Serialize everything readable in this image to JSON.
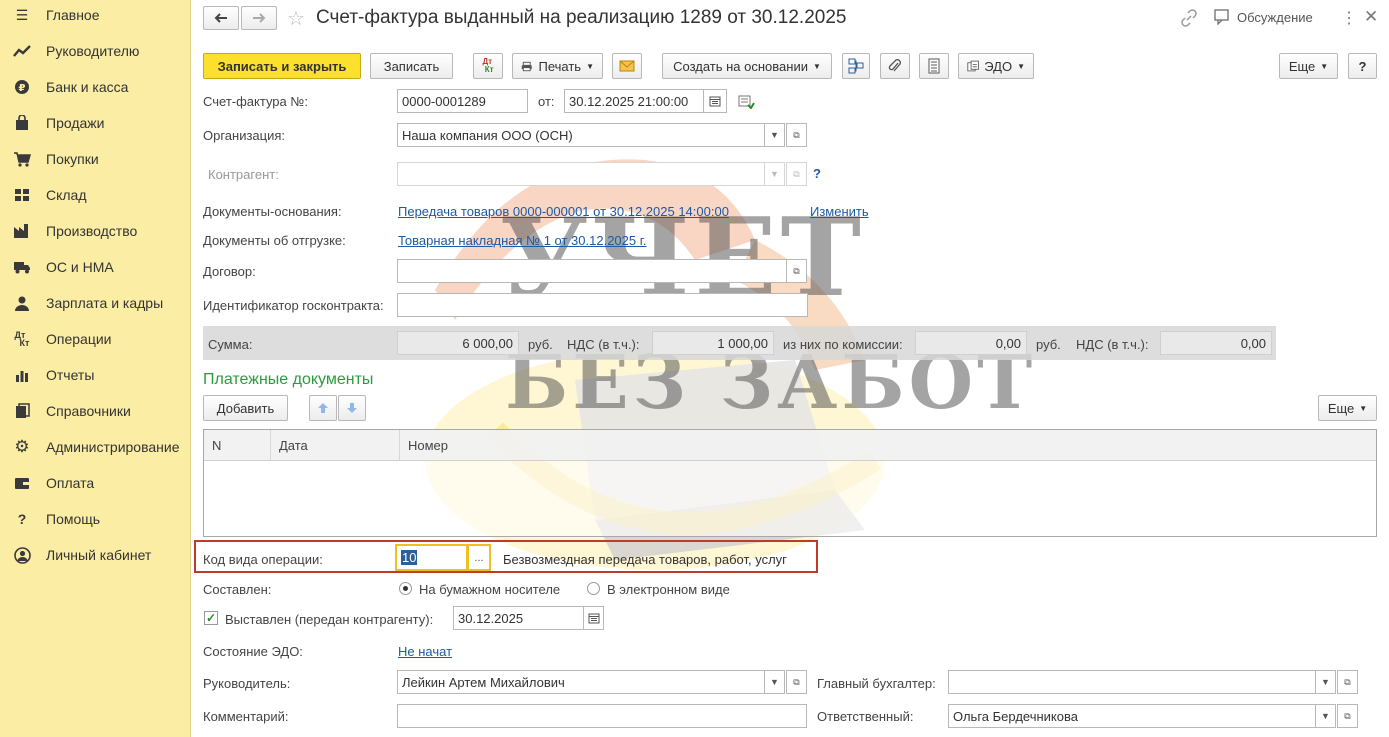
{
  "sidebar": {
    "menu_icon": "hamburger-icon",
    "items": [
      {
        "label": "Главное",
        "icon": "menu-icon"
      },
      {
        "label": "Руководителю",
        "icon": "trend-icon"
      },
      {
        "label": "Банк и касса",
        "icon": "coin-icon"
      },
      {
        "label": "Продажи",
        "icon": "bag-icon"
      },
      {
        "label": "Покупки",
        "icon": "cart-icon"
      },
      {
        "label": "Склад",
        "icon": "warehouse-icon"
      },
      {
        "label": "Производство",
        "icon": "factory-icon"
      },
      {
        "label": "ОС и НМА",
        "icon": "truck-icon"
      },
      {
        "label": "Зарплата и кадры",
        "icon": "person-icon"
      },
      {
        "label": "Операции",
        "icon": "dt-kt-icon"
      },
      {
        "label": "Отчеты",
        "icon": "bar-chart-icon"
      },
      {
        "label": "Справочники",
        "icon": "books-icon"
      },
      {
        "label": "Администрирование",
        "icon": "gear-icon"
      },
      {
        "label": "Оплата",
        "icon": "wallet-icon"
      },
      {
        "label": "Помощь",
        "icon": "question-icon"
      },
      {
        "label": "Личный кабинет",
        "icon": "user-circle-icon"
      }
    ]
  },
  "header": {
    "title": "Счет-фактура выданный на реализацию 1289 от 30.12.2025",
    "discussion": "Обсуждение"
  },
  "toolbar": {
    "save_close": "Записать и закрыть",
    "save": "Записать",
    "dtkt": "Дт\nКт",
    "print": "Печать",
    "create_based": "Создать на основании",
    "edo": "ЭДО",
    "more": "Еще",
    "help": "?"
  },
  "form": {
    "invoice_no_label": "Счет-фактура №:",
    "invoice_no": "0000-0001289",
    "from_label": "от:",
    "date": "30.12.2025 21:00:00",
    "org_label": "Организация:",
    "org": "Наша компания ООО (ОСН)",
    "counterparty_label": "Контрагент:",
    "counterparty": "",
    "counterparty_help": "?",
    "base_docs_label": "Документы-основания:",
    "base_docs_link": "Передача товаров 0000-000001 от 30.12.2025 14:00:00",
    "change_link": "Изменить",
    "shipment_docs_label": "Документы об отгрузке:",
    "shipment_docs_link": "Товарная накладная № 1 от 30.12.2025 г.",
    "contract_label": "Договор:",
    "contract": "",
    "gov_contract_label": "Идентификатор госконтракта:",
    "gov_contract": ""
  },
  "sums": {
    "sum_label": "Сумма:",
    "sum": "6 000,00",
    "currency1": "руб.",
    "vat_label": "НДС (в т.ч.):",
    "vat": "1 000,00",
    "commission_label": "из них по комиссии:",
    "commission": "0,00",
    "currency2": "руб.",
    "vat2_label": "НДС (в т.ч.):",
    "vat2": "0,00"
  },
  "payments": {
    "title": "Платежные документы",
    "add": "Добавить",
    "more": "Еще",
    "columns": [
      "N",
      "Дата",
      "Номер"
    ]
  },
  "operation": {
    "label": "Код вида операции:",
    "code": "10",
    "dots": "...",
    "description": "Безвозмездная передача товаров, работ, услуг"
  },
  "composed": {
    "label": "Составлен:",
    "paper": "На бумажном носителе",
    "electronic": "В электронном виде"
  },
  "issued": {
    "label": "Выставлен (передан контрагенту):",
    "date": "30.12.2025"
  },
  "edo_state": {
    "label": "Состояние ЭДО:",
    "value": "Не начат"
  },
  "signers": {
    "head_label": "Руководитель:",
    "head": "Лейкин Артем Михайлович",
    "chief_acc_label": "Главный бухгалтер:",
    "chief_acc": "",
    "comment_label": "Комментарий:",
    "comment": "",
    "responsible_label": "Ответственный:",
    "responsible": "Ольга Бердечникова"
  },
  "watermark": {
    "line1": "УЧЕТ",
    "line2": "БЕЗ ЗАБОТ"
  },
  "colors": {
    "sidebar_bg": "#fbeda4",
    "primary_button": "#fde02d",
    "link": "#1c5aa6",
    "section_title": "#2e9a3e",
    "highlight_border": "#c0392b"
  }
}
